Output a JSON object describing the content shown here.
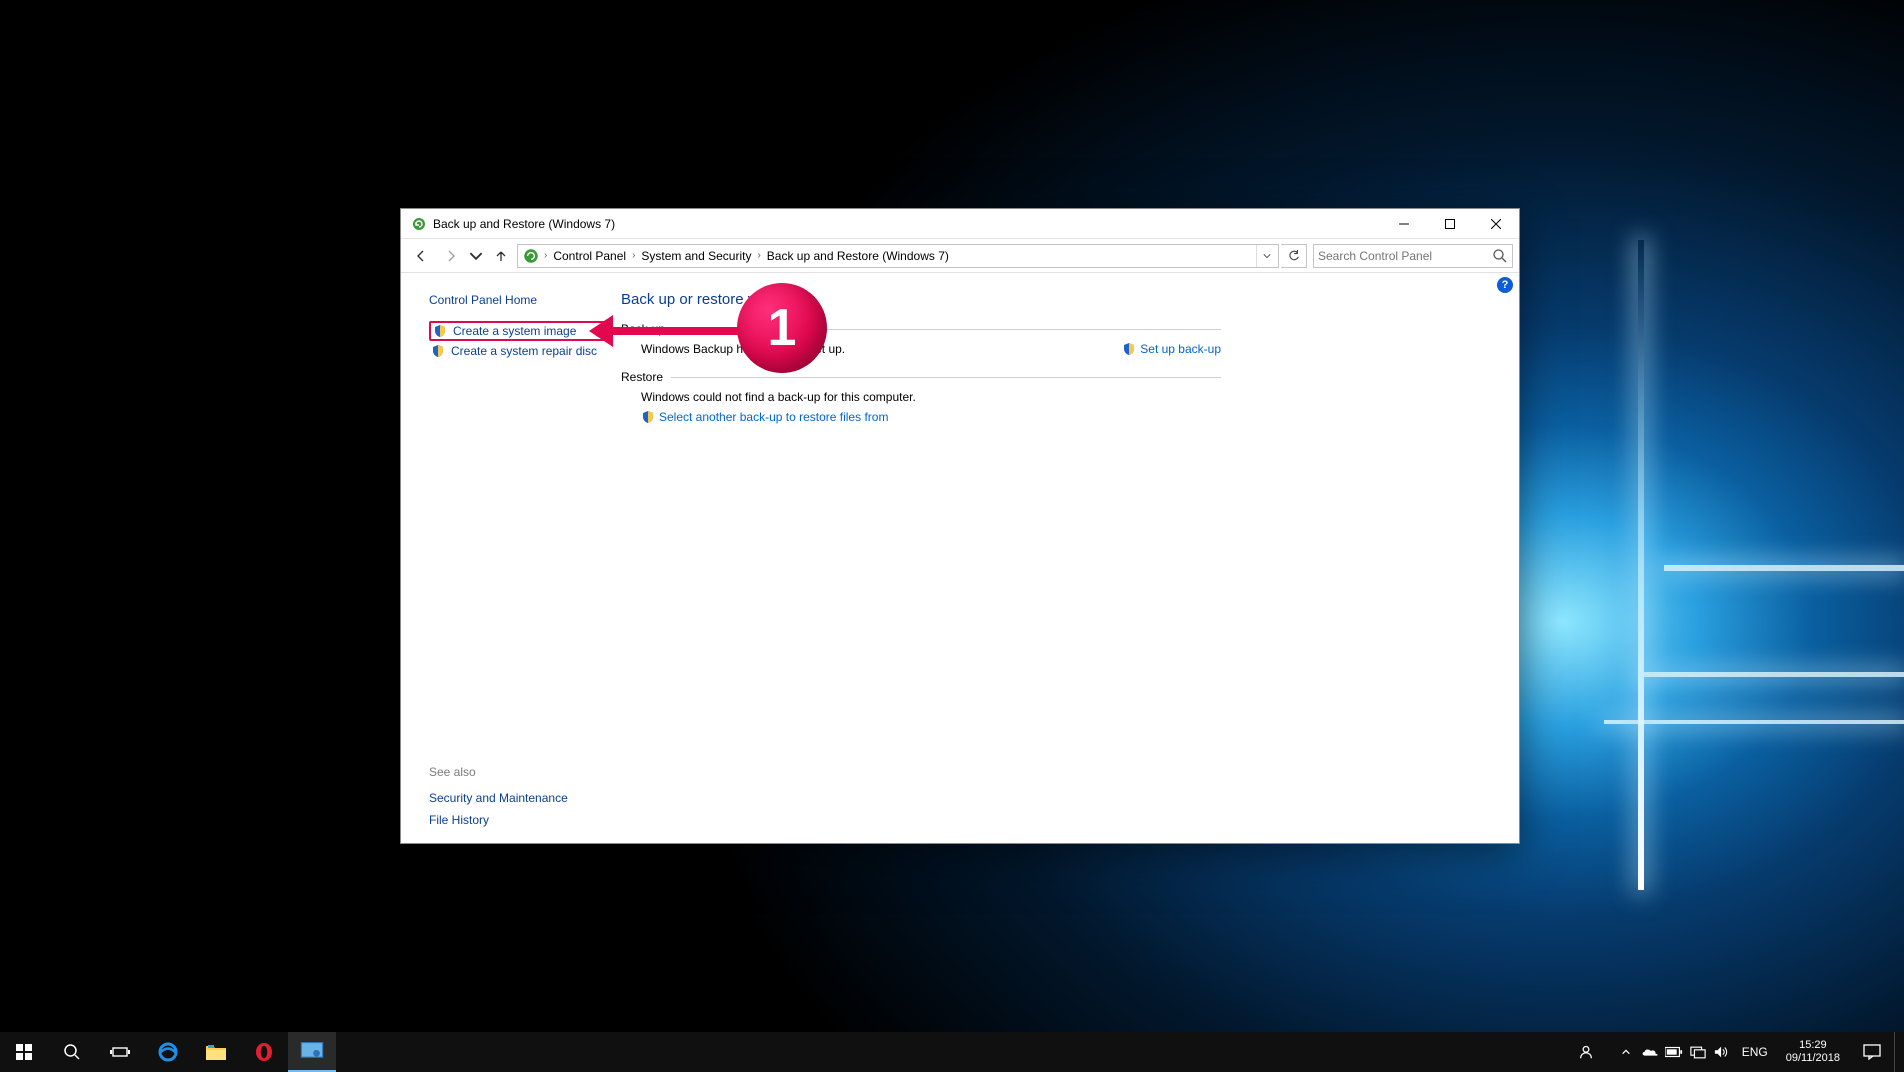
{
  "window": {
    "title": "Back up and Restore (Windows 7)"
  },
  "breadcrumb": {
    "items": [
      "Control Panel",
      "System and Security",
      "Back up and Restore (Windows 7)"
    ]
  },
  "search": {
    "placeholder": "Search Control Panel"
  },
  "sidebar": {
    "cp_home": "Control Panel Home",
    "create_image": "Create a system image",
    "create_repair": "Create a system repair disc",
    "see_also": "See also",
    "security": "Security and Maintenance",
    "file_history": "File History"
  },
  "main": {
    "heading": "Back up or restore your files",
    "backup_label": "Back-up",
    "backup_status": "Windows Backup has not been set up.",
    "setup_backup": "Set up back-up",
    "restore_label": "Restore",
    "restore_status": "Windows could not find a back-up for this computer.",
    "restore_link": "Select another back-up to restore files from"
  },
  "annotation": {
    "number": "1"
  },
  "taskbar": {
    "lang": "ENG",
    "time": "15:29",
    "date": "09/11/2018"
  }
}
